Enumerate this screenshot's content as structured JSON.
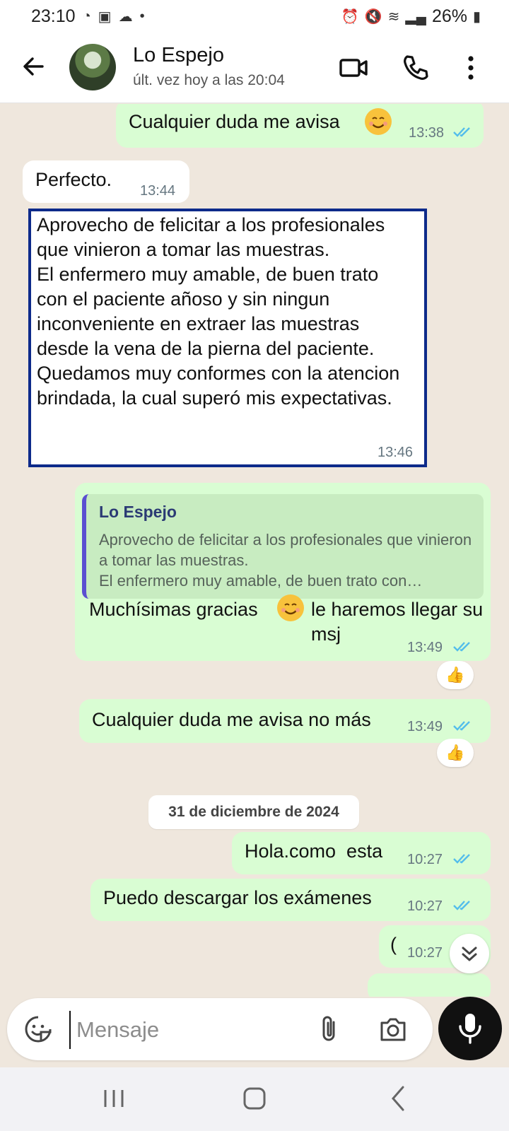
{
  "status_bar": {
    "time": "23:10",
    "battery": "26%"
  },
  "header": {
    "contact_name": "Lo Espejo",
    "last_seen": "últ. vez hoy a las 20:04"
  },
  "messages": [
    {
      "dir": "out",
      "text": "Cualquier duda me avisa",
      "time": "13:38"
    },
    {
      "dir": "in",
      "text": "Perfecto.",
      "time": "13:44"
    },
    {
      "dir": "in",
      "text": "Aprovecho de felicitar a los profesionales que vinieron a tomar las muestras.\nEl enfermero muy amable, de buen trato con el paciente añoso y sin ningun inconveniente en extraer las muestras desde la vena de la pierna del paciente.\nQuedamos muy conformes con la atencion brindada, la cual superó mis expectativas.",
      "time": "13:46"
    },
    {
      "dir": "out",
      "quote_author": "Lo Espejo",
      "quote_text": "Aprovecho de felicitar a los profesionales que vinieron a tomar las muestras.\nEl enfermero muy amable, de buen trato con…",
      "text_a": "Muchísimas gracias",
      "text_b": "le haremos llegar su msj",
      "time": "13:49",
      "reaction": "👍"
    },
    {
      "dir": "out",
      "text": "Cualquier duda me avisa no más",
      "time": "13:49",
      "reaction": "👍"
    },
    {
      "dir": "out",
      "text": "Hola.como  esta",
      "time": "10:27"
    },
    {
      "dir": "out",
      "text": "Puedo descargar los exámenes",
      "time": "10:27"
    },
    {
      "dir": "out",
      "text": "(",
      "time": "10:27"
    }
  ],
  "date_divider": "31 de diciembre de 2024",
  "composer": {
    "placeholder": "Mensaje"
  },
  "colors": {
    "outgoing_bubble": "#d9fdd3",
    "incoming_bubble": "#ffffff",
    "read_tick": "#53bdeb",
    "chat_bg": "#efe7dd"
  },
  "icons": [
    "back-arrow-icon",
    "video-call-icon",
    "phone-icon",
    "more-icon",
    "emoji-sticker-icon",
    "attach-icon",
    "camera-icon",
    "mic-icon",
    "scroll-down-icon"
  ]
}
